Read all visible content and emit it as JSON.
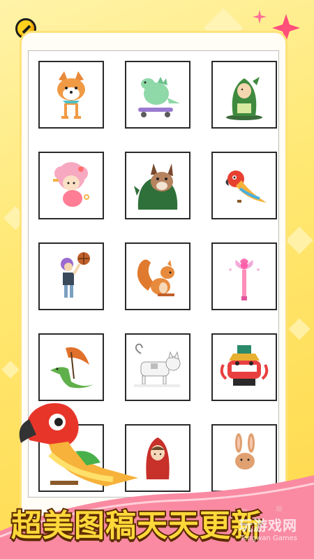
{
  "banner": {
    "title": "超美图稿天天更新"
  },
  "watermark": {
    "cn": "玩游戏网",
    "en": "Tengwan Games"
  },
  "gallery": {
    "items": [
      {
        "icon": "shiba-dog-icon"
      },
      {
        "icon": "skateboard-dinosaur-icon"
      },
      {
        "icon": "dinosaur-costume-icon"
      },
      {
        "icon": "pink-hair-girl-icon"
      },
      {
        "icon": "bulldog-dino-costume-icon"
      },
      {
        "icon": "parrot-icon"
      },
      {
        "icon": "basketball-player-icon"
      },
      {
        "icon": "squirrel-icon"
      },
      {
        "icon": "magic-wand-icon"
      },
      {
        "icon": "umbrella-crocodile-icon"
      },
      {
        "icon": "white-cat-icon"
      },
      {
        "icon": "lion-dance-icon"
      },
      {
        "icon": "partial-tile-icon"
      },
      {
        "icon": "red-riding-hood-icon"
      },
      {
        "icon": "bunny-icon"
      }
    ]
  },
  "colors": {
    "background": "#ffe873",
    "banner_pink": "#f98aa2",
    "banner_text": "#ffd83a",
    "banner_outline": "#5a2a00"
  }
}
